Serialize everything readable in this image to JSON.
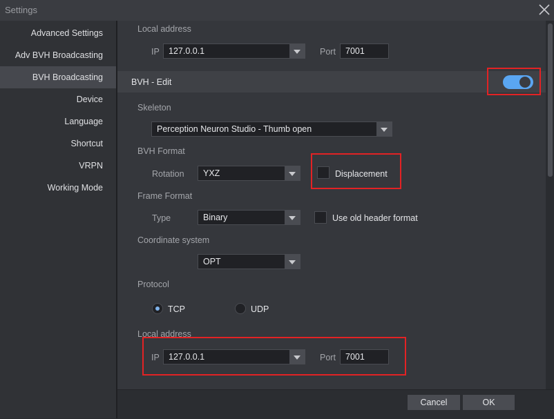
{
  "window": {
    "title": "Settings"
  },
  "sidebar": {
    "items": [
      {
        "label": "Advanced Settings"
      },
      {
        "label": "Adv BVH Broadcasting"
      },
      {
        "label": "BVH Broadcasting",
        "active": true
      },
      {
        "label": "Device"
      },
      {
        "label": "Language"
      },
      {
        "label": "Shortcut"
      },
      {
        "label": "VRPN"
      },
      {
        "label": "Working Mode"
      }
    ]
  },
  "top_local_address": {
    "label": "Local address",
    "ip_label": "IP",
    "ip_value": "127.0.0.1",
    "port_label": "Port",
    "port_value": "7001"
  },
  "bvh_edit": {
    "title": "BVH - Edit",
    "toggle_on": true,
    "skeleton_label": "Skeleton",
    "skeleton_value": "Perception Neuron Studio - Thumb open",
    "bvh_format_label": "BVH Format",
    "rotation_label": "Rotation",
    "rotation_value": "YXZ",
    "displacement_label": "Displacement",
    "displacement_checked": false,
    "frame_format_label": "Frame Format",
    "type_label": "Type",
    "type_value": "Binary",
    "old_header_label": "Use old header format",
    "old_header_checked": false,
    "coord_label": "Coordinate system",
    "coord_value": "OPT",
    "protocol_label": "Protocol",
    "protocol_options": [
      "TCP",
      "UDP"
    ],
    "protocol_selected": "TCP",
    "local_address_label": "Local address",
    "ip_label": "IP",
    "ip_value": "127.0.0.1",
    "port_label": "Port",
    "port_value": "7001"
  },
  "footer": {
    "cancel_label": "Cancel",
    "ok_label": "OK"
  },
  "colors": {
    "accent": "#5aa6f2",
    "highlight": "#e32224"
  }
}
